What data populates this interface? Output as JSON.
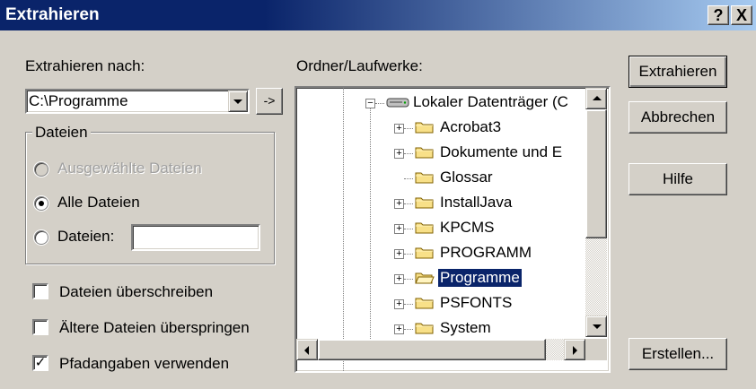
{
  "window": {
    "title": "Extrahieren",
    "help_btn": "?",
    "close_btn": "X"
  },
  "extract_to": {
    "label": "Extrahieren nach:",
    "value": "C:\\Programme",
    "arrow_button": "->"
  },
  "files_group": {
    "legend": "Dateien",
    "options": [
      {
        "label": "Ausgewählte Dateien",
        "checked": false,
        "enabled": false
      },
      {
        "label": "Alle Dateien",
        "checked": true,
        "enabled": true
      },
      {
        "label": "Dateien:",
        "checked": false,
        "enabled": true
      }
    ],
    "files_value": ""
  },
  "checkboxes": [
    {
      "label": "Dateien überschreiben",
      "checked": false
    },
    {
      "label": "Ältere Dateien überspringen",
      "checked": false
    },
    {
      "label": "Pfadangaben verwenden",
      "checked": true
    }
  ],
  "folders": {
    "label": "Ordner/Laufwerke:",
    "drive": "Lokaler Datenträger (C",
    "items": [
      {
        "name": "Acrobat3",
        "expandable": true,
        "selected": false
      },
      {
        "name": "Dokumente und E",
        "expandable": true,
        "selected": false
      },
      {
        "name": "Glossar",
        "expandable": false,
        "selected": false
      },
      {
        "name": "InstallJava",
        "expandable": true,
        "selected": false
      },
      {
        "name": "KPCMS",
        "expandable": true,
        "selected": false
      },
      {
        "name": "PROGRAMM",
        "expandable": true,
        "selected": false
      },
      {
        "name": "Programme",
        "expandable": true,
        "selected": true
      },
      {
        "name": "PSFONTS",
        "expandable": true,
        "selected": false
      },
      {
        "name": "System",
        "expandable": true,
        "selected": false
      }
    ]
  },
  "buttons": {
    "extract": "Extrahieren",
    "cancel": "Abbrechen",
    "help": "Hilfe",
    "create": "Erstellen..."
  },
  "colors": {
    "titlebar": "#0a246a",
    "face": "#d4d0c8",
    "selection": "#0a246a",
    "folder": "#f8e088"
  }
}
